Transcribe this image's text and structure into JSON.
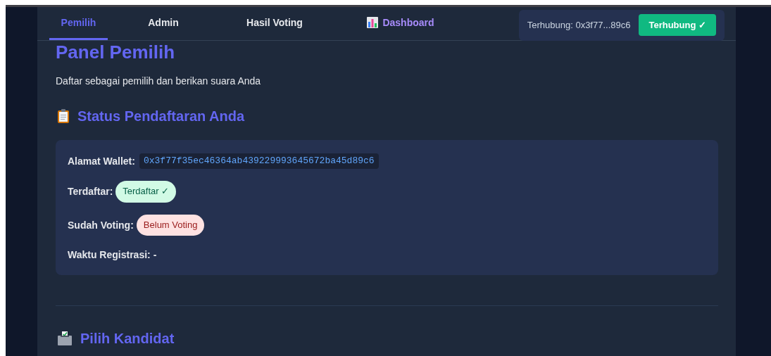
{
  "tabs": [
    {
      "label": "Pemilih",
      "selected": true,
      "kind": "text"
    },
    {
      "label": "Admin",
      "selected": false,
      "kind": "text"
    },
    {
      "label": "Hasil Voting",
      "selected": false,
      "kind": "text"
    },
    {
      "label": "Dashboard",
      "selected": false,
      "kind": "dashboard"
    }
  ],
  "connection": {
    "label": "Terhubung: 0x3f77...89c6",
    "button": "Terhubung ✓"
  },
  "page": {
    "title": "Panel Pemilih",
    "subtitle": "Daftar sebagai pemilih dan berikan suara Anda"
  },
  "status_section": {
    "title": "Status Pendaftaran Anda",
    "fields": [
      {
        "label": "Alamat Wallet:",
        "kind": "code",
        "value": "0x3f77f35ec46364ab439229993645672ba45d89c6"
      },
      {
        "label": "Terdaftar:",
        "kind": "badge",
        "value": "Terdaftar ✓",
        "positive": true
      },
      {
        "label": "Sudah Voting:",
        "kind": "badge",
        "value": "Belum Voting",
        "positive": false
      },
      {
        "label": "Waktu Registrasi:",
        "kind": "text",
        "value": "-"
      }
    ]
  },
  "candidates_section": {
    "title": "Pilih Kandidat"
  }
}
